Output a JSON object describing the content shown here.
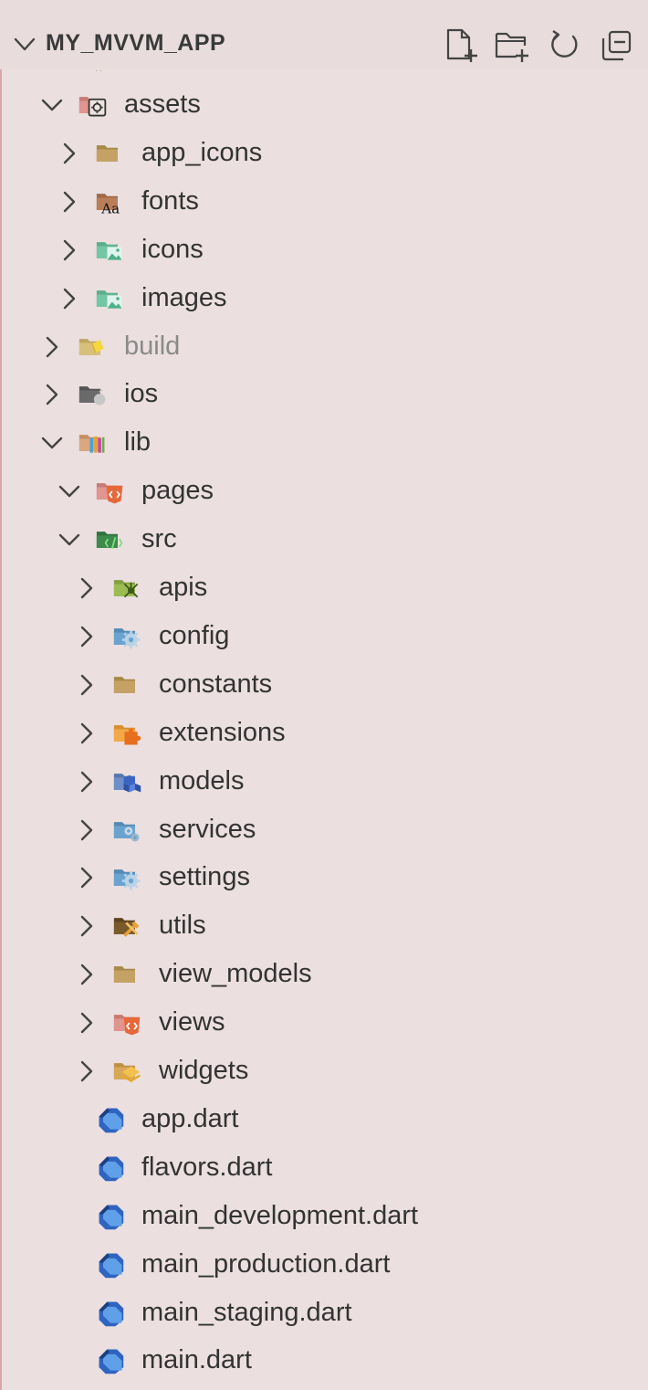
{
  "explorer": {
    "title": "MY_MVVM_APP",
    "actions": [
      "new-file",
      "new-folder",
      "refresh",
      "collapse-all"
    ]
  },
  "tree": [
    {
      "label": "assets",
      "depth": 0,
      "state": "expanded",
      "icon": "assets-folder-icon"
    },
    {
      "label": "app_icons",
      "depth": 1,
      "state": "collapsed",
      "icon": "folder-icon"
    },
    {
      "label": "fonts",
      "depth": 1,
      "state": "collapsed",
      "icon": "font-folder-icon"
    },
    {
      "label": "icons",
      "depth": 1,
      "state": "collapsed",
      "icon": "image-folder-icon"
    },
    {
      "label": "images",
      "depth": 1,
      "state": "collapsed",
      "icon": "image-folder-icon"
    },
    {
      "label": "build",
      "depth": 0,
      "state": "collapsed",
      "icon": "build-folder-icon",
      "dim": true
    },
    {
      "label": "ios",
      "depth": 0,
      "state": "collapsed",
      "icon": "ios-folder-icon"
    },
    {
      "label": "lib",
      "depth": 0,
      "state": "expanded",
      "icon": "lib-folder-icon"
    },
    {
      "label": "pages",
      "depth": 1,
      "state": "expanded",
      "icon": "html-folder-icon"
    },
    {
      "label": "src",
      "depth": 1,
      "state": "expanded",
      "icon": "src-folder-icon"
    },
    {
      "label": "apis",
      "depth": 2,
      "state": "collapsed",
      "icon": "api-folder-icon"
    },
    {
      "label": "config",
      "depth": 2,
      "state": "collapsed",
      "icon": "config-folder-icon"
    },
    {
      "label": "constants",
      "depth": 2,
      "state": "collapsed",
      "icon": "folder-icon"
    },
    {
      "label": "extensions",
      "depth": 2,
      "state": "collapsed",
      "icon": "extension-folder-icon"
    },
    {
      "label": "models",
      "depth": 2,
      "state": "collapsed",
      "icon": "models-folder-icon"
    },
    {
      "label": "services",
      "depth": 2,
      "state": "collapsed",
      "icon": "services-folder-icon"
    },
    {
      "label": "settings",
      "depth": 2,
      "state": "collapsed",
      "icon": "config-folder-icon"
    },
    {
      "label": "utils",
      "depth": 2,
      "state": "collapsed",
      "icon": "utils-folder-icon"
    },
    {
      "label": "view_models",
      "depth": 2,
      "state": "collapsed",
      "icon": "folder-icon"
    },
    {
      "label": "views",
      "depth": 2,
      "state": "collapsed",
      "icon": "html-folder-icon"
    },
    {
      "label": "widgets",
      "depth": 2,
      "state": "collapsed",
      "icon": "widgets-folder-icon"
    },
    {
      "label": "app.dart",
      "depth": 1,
      "state": "file",
      "icon": "dart-file-icon"
    },
    {
      "label": "flavors.dart",
      "depth": 1,
      "state": "file",
      "icon": "dart-file-icon"
    },
    {
      "label": "main_development.dart",
      "depth": 1,
      "state": "file",
      "icon": "dart-file-icon"
    },
    {
      "label": "main_production.dart",
      "depth": 1,
      "state": "file",
      "icon": "dart-file-icon"
    },
    {
      "label": "main_staging.dart",
      "depth": 1,
      "state": "file",
      "icon": "dart-file-icon"
    },
    {
      "label": "main.dart",
      "depth": 1,
      "state": "file",
      "icon": "dart-file-icon"
    }
  ]
}
